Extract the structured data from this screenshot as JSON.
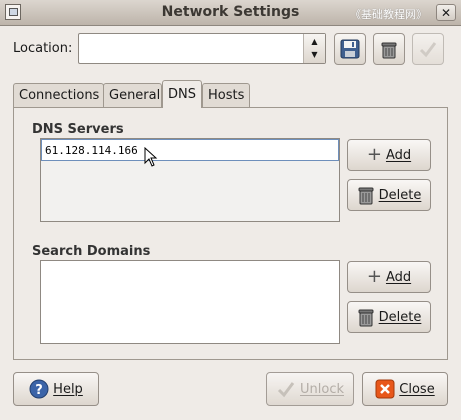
{
  "window": {
    "title": "Network Settings",
    "watermark": "《基础教程网》",
    "close_glyph": "✕"
  },
  "location": {
    "label": "Location:",
    "value": ""
  },
  "tabs": [
    {
      "label": "Connections"
    },
    {
      "label": "General"
    },
    {
      "label": "DNS",
      "active": true
    },
    {
      "label": "Hosts"
    }
  ],
  "dns": {
    "servers_label": "DNS Servers",
    "server_value": "61.128.114.166",
    "add_label": "Add",
    "delete_label": "Delete"
  },
  "search": {
    "label": "Search Domains",
    "add_label": "Add",
    "delete_label": "Delete"
  },
  "footer": {
    "help": "Help",
    "unlock": "Unlock",
    "close": "Close"
  },
  "colors": {
    "close_icon": "#e8571a",
    "help_icon": "#3b64a8"
  }
}
